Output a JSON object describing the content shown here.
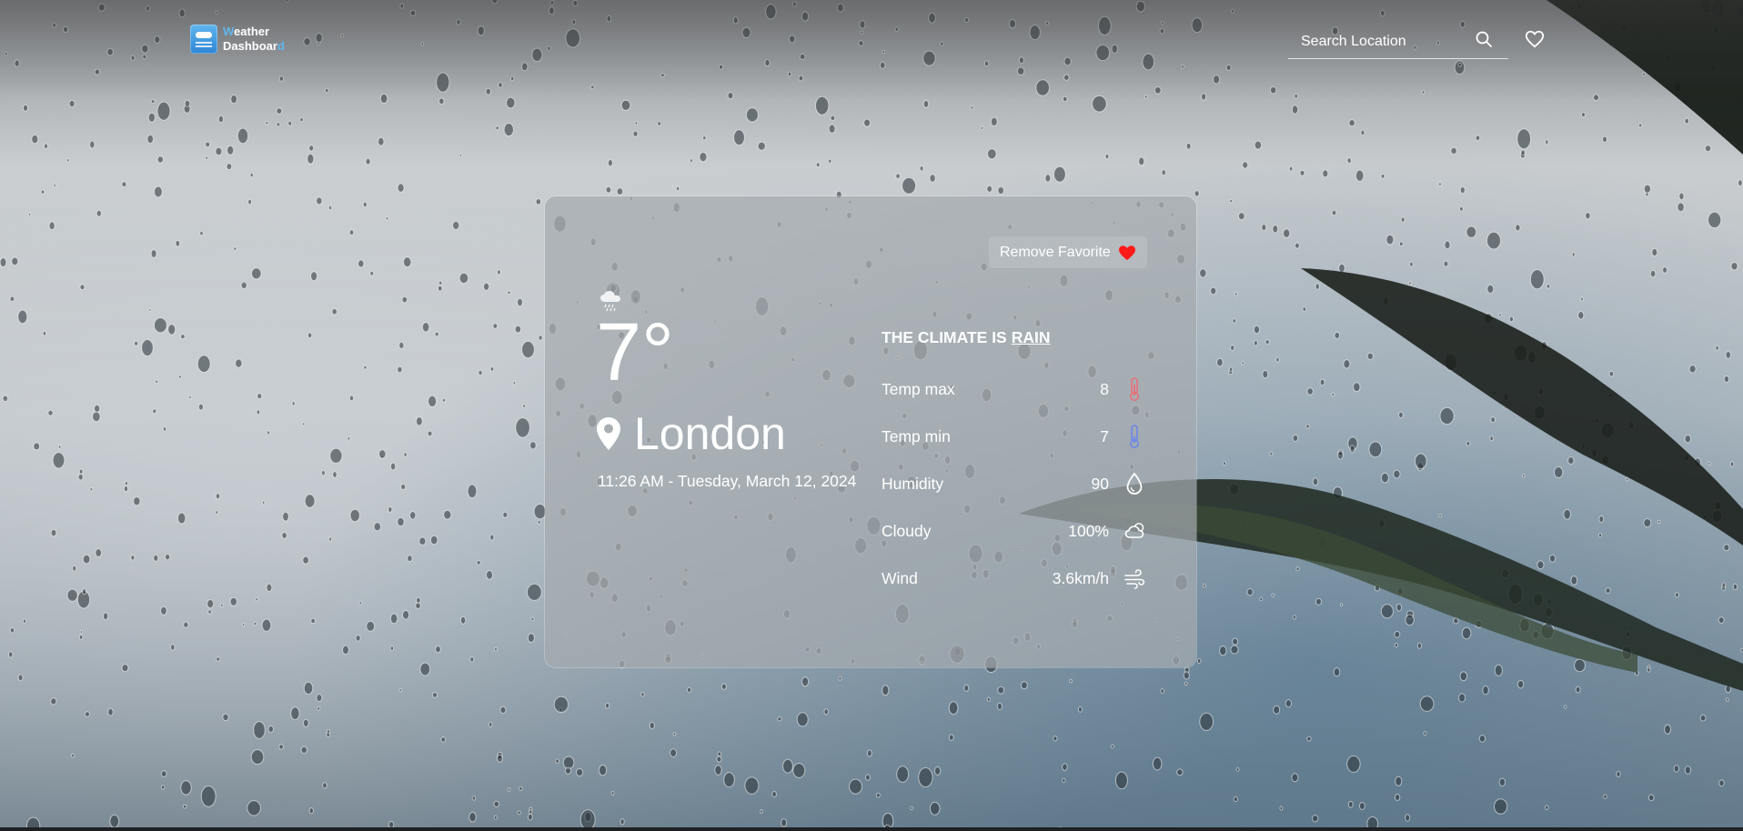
{
  "header": {
    "brand_line1_first": "W",
    "brand_line1_rest": "eather",
    "brand_line2_main": "Dashboar",
    "brand_line2_last": "d",
    "search_placeholder": "Search Location",
    "accent_color": "#5fb6ee"
  },
  "card": {
    "favorite_button_label": "Remove Favorite",
    "temperature": "7°",
    "city": "London",
    "datetime": "11:26 AM - Tuesday, March 12, 2024",
    "climate_prefix": "THE CLIMATE IS",
    "climate_condition": "RAIN",
    "stats": [
      {
        "label": "Temp max",
        "value": "8",
        "icon": "thermometer-hot-icon",
        "color": "#e8707a"
      },
      {
        "label": "Temp min",
        "value": "7",
        "icon": "thermometer-cold-icon",
        "color": "#6d86e8"
      },
      {
        "label": "Humidity",
        "value": "90",
        "icon": "water-drop-icon",
        "color": "#ffffff"
      },
      {
        "label": "Cloudy",
        "value": "100%",
        "icon": "cloud-icon",
        "color": "#ffffff"
      },
      {
        "label": "Wind",
        "value": "3.6km/h",
        "icon": "wind-icon",
        "color": "#ffffff"
      }
    ],
    "favorite_heart_color": "#ff1a1a"
  }
}
